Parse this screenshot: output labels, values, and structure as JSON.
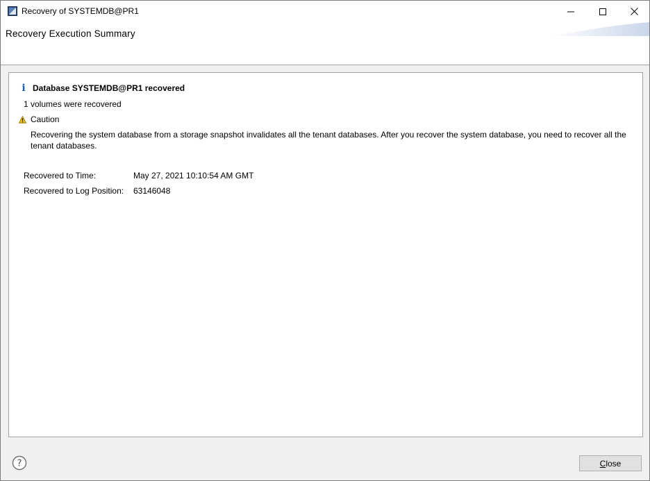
{
  "window": {
    "title": "Recovery of SYSTEMDB@PR1"
  },
  "header": {
    "title": "Recovery Execution Summary"
  },
  "summary": {
    "status_title": "Database SYSTEMDB@PR1 recovered",
    "volumes_text": "1 volumes were recovered",
    "caution_label": "Caution",
    "caution_text": "Recovering the system database from a storage snapshot invalidates all the tenant databases. After you recover the system database, you need to recover all the tenant databases."
  },
  "details": [
    {
      "label": "Recovered to Time:",
      "value": "May 27, 2021 10:10:54 AM GMT"
    },
    {
      "label": "Recovered to Log Position:",
      "value": "63146048"
    }
  ],
  "footer": {
    "close_label": "Close"
  },
  "colors": {
    "info_icon": "#1a5fb4",
    "caution_icon": "#f5c211"
  }
}
